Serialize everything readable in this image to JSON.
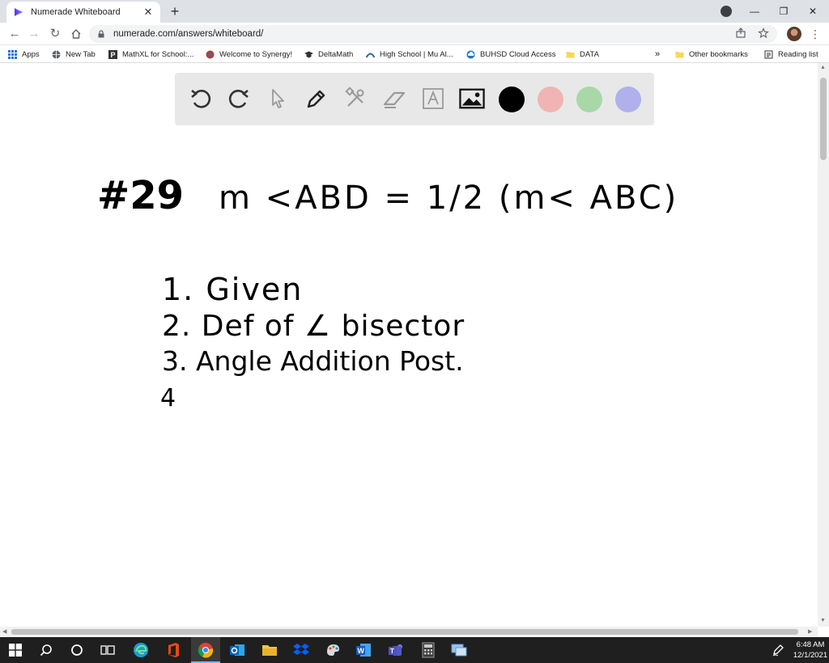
{
  "browser": {
    "tab_title": "Numerade Whiteboard",
    "tab_close": "✕",
    "new_tab": "+",
    "url": "numerade.com/answers/whiteboard/",
    "window_controls": {
      "minimize": "—",
      "restore": "❐",
      "close": "✕"
    }
  },
  "bookmarks": {
    "items": [
      {
        "label": "Apps"
      },
      {
        "label": "New Tab"
      },
      {
        "label": "MathXL for School:..."
      },
      {
        "label": "Welcome to Synergy!"
      },
      {
        "label": "DeltaMath"
      },
      {
        "label": "High School | Mu Al..."
      },
      {
        "label": "BUHSD Cloud Access"
      },
      {
        "label": "DATA"
      }
    ],
    "overflow": "»",
    "other": "Other bookmarks",
    "reading_list": "Reading list"
  },
  "whiteboard": {
    "colors": {
      "black": "#000000",
      "red": "#f0b4b4",
      "green": "#a8d8a8",
      "blue": "#b0b0ec"
    },
    "problem": "#29",
    "statement": "m <ABD = 1/2 (m< ABC)",
    "steps": [
      "1. Given",
      "2. Def of ∠ bisector",
      "3. Angle Addition Post."
    ],
    "step_4": "4"
  },
  "taskbar": {
    "time": "6:48 AM",
    "date": "12/1/2021"
  }
}
